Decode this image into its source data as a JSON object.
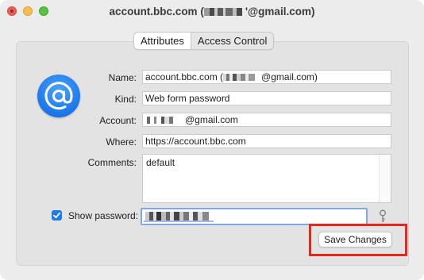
{
  "window": {
    "title_prefix": "account.bbc.com (",
    "title_suffix": "'@gmail.com)"
  },
  "tabs": [
    {
      "label": "Attributes",
      "selected": true
    },
    {
      "label": "Access Control",
      "selected": false
    }
  ],
  "icon": {
    "name": "at-sign-icon",
    "color": "#1b76e8"
  },
  "form": {
    "name_label": "Name:",
    "name_prefix": "account.bbc.com (",
    "name_suffix": "@gmail.com)",
    "kind_label": "Kind:",
    "kind_value": "Web form password",
    "account_label": "Account:",
    "account_suffix": "@gmail.com",
    "where_label": "Where:",
    "where_value": "https://account.bbc.com",
    "comments_label": "Comments:",
    "comments_value": "default",
    "show_password_label": "Show password:",
    "show_password_checked": true
  },
  "actions": {
    "save_label": "Save Changes"
  },
  "annotation": {
    "highlight_color": "#e8261c"
  }
}
